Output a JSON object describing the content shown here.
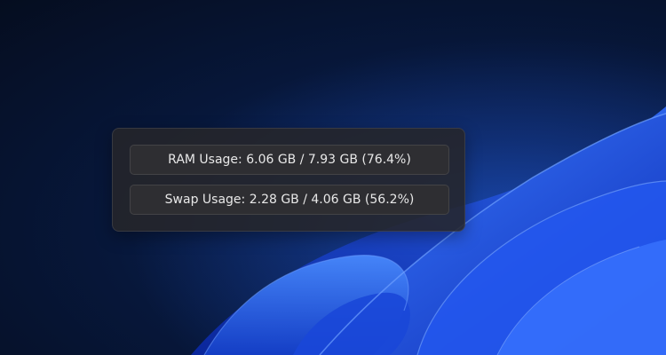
{
  "widget": {
    "ram_usage_text": "RAM Usage: 6.06 GB / 7.93 GB (76.4%)",
    "swap_usage_text": "Swap Usage: 2.28 GB / 4.06 GB (56.2%)"
  },
  "colors": {
    "desktop_dark": "#050d1f",
    "wallpaper_blue": "#1f52e8",
    "widget_background": "#26262a",
    "row_background": "#2e2e32",
    "text": "#e8e8e8"
  }
}
